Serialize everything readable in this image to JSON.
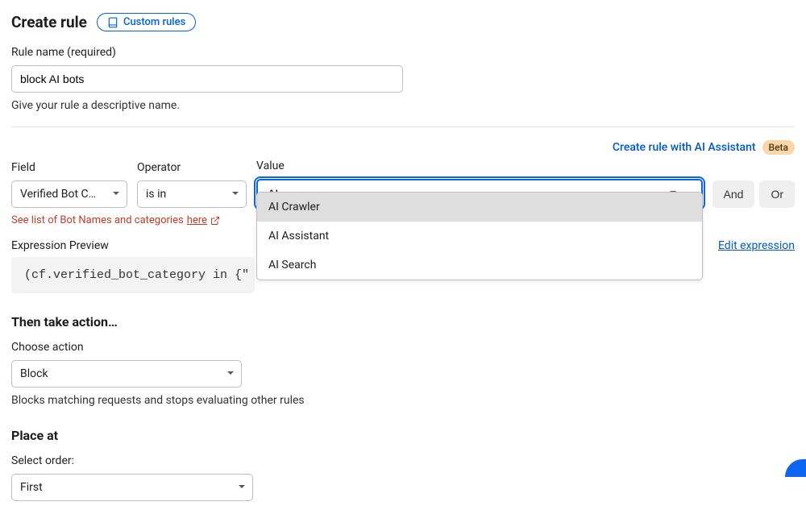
{
  "header": {
    "title": "Create rule",
    "custom_rules_label": "Custom rules"
  },
  "rule_name": {
    "label": "Rule name (required)",
    "value": "block AI bots",
    "helper": "Give your rule a descriptive name."
  },
  "ai_assist": {
    "link": "Create rule with AI Assistant",
    "beta": "Beta"
  },
  "builder": {
    "field_label": "Field",
    "field_value": "Verified Bot C…",
    "operator_label": "Operator",
    "operator_value": "is in",
    "value_label": "Value",
    "value_input": "AI",
    "and": "And",
    "or": "Or",
    "dropdown_options": [
      "AI Crawler",
      "AI Assistant",
      "AI Search"
    ]
  },
  "bot_link": {
    "prefix": "See list of Bot Names and categories ",
    "here": "here"
  },
  "expression": {
    "label": "Expression Preview",
    "edit": "Edit expression",
    "value": "(cf.verified_bot_category in {\""
  },
  "action": {
    "heading": "Then take action…",
    "choose_label": "Choose action",
    "value": "Block",
    "helper": "Blocks matching requests and stops evaluating other rules"
  },
  "placement": {
    "heading": "Place at",
    "order_label": "Select order:",
    "value": "First"
  }
}
